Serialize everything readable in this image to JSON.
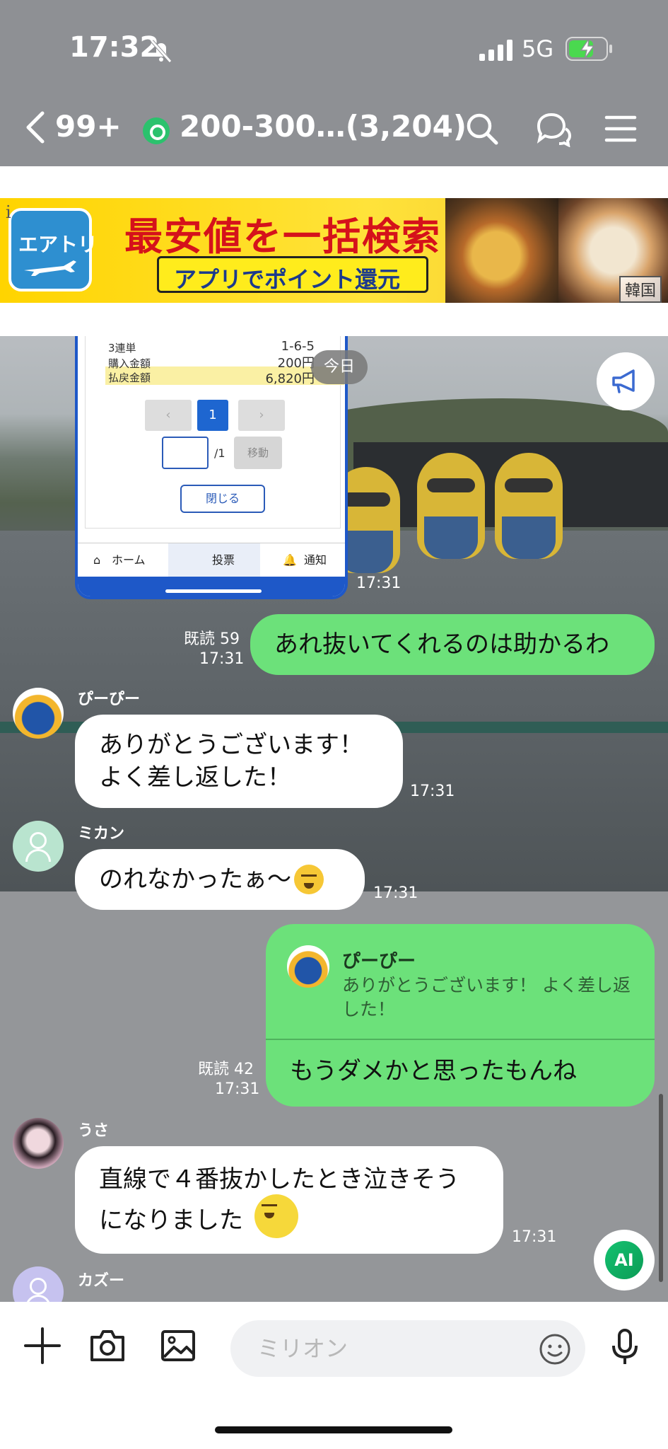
{
  "status_bar": {
    "time": "17:32",
    "network": "5G"
  },
  "header": {
    "unread_count": "99+",
    "chat_title": "200-300…(3,204)"
  },
  "ad": {
    "info_mark": "i",
    "app_name": "エアトリ",
    "headline": "最安値を一括検索",
    "subline": "アプリでポイント還元",
    "country_tag": "韓国"
  },
  "date_pill": "今日",
  "screenshot": {
    "rows": [
      {
        "label": "3連単",
        "value": "1-6-5"
      },
      {
        "label": "購入金額",
        "value": "200円"
      },
      {
        "label": "払戻金額",
        "value": "6,820円"
      }
    ],
    "pager": {
      "prev": "‹",
      "current": "1",
      "next": "›",
      "total": "/1",
      "go": "移動",
      "close": "閉じる"
    },
    "tabs": [
      "ホーム",
      "投票",
      "通知"
    ],
    "time": "17:31"
  },
  "messages": [
    {
      "id": "m1",
      "direction": "out",
      "text": "あれ抜いてくれるのは助かるわ",
      "read": "既読 59",
      "time": "17:31"
    },
    {
      "id": "m2",
      "direction": "in",
      "sender": "ぴーぴー",
      "text": "ありがとうございます！\nよく差し返した！",
      "time": "17:31"
    },
    {
      "id": "m3",
      "direction": "in",
      "sender": "ミカン",
      "text": "のれなかったぁ〜",
      "time": "17:31"
    },
    {
      "id": "m4",
      "direction": "out",
      "quote": {
        "sender": "ぴーぴー",
        "text": "ありがとうございます！ よく差し返した！"
      },
      "text": "もうダメかと思ったもんね",
      "read": "既読 42",
      "time": "17:31"
    },
    {
      "id": "m5",
      "direction": "in",
      "sender": "うさ",
      "text": "直線で４番抜かしたとき泣きそう\nになりました",
      "time": "17:31"
    },
    {
      "id": "m6",
      "direction": "in",
      "sender": "カズー"
    }
  ],
  "ai_button": "AI",
  "input": {
    "placeholder": "ミリオン"
  },
  "colors": {
    "bubble_out": "#6ce17a",
    "bubble_in": "#ffffff",
    "line_green": "#2bc26d"
  }
}
